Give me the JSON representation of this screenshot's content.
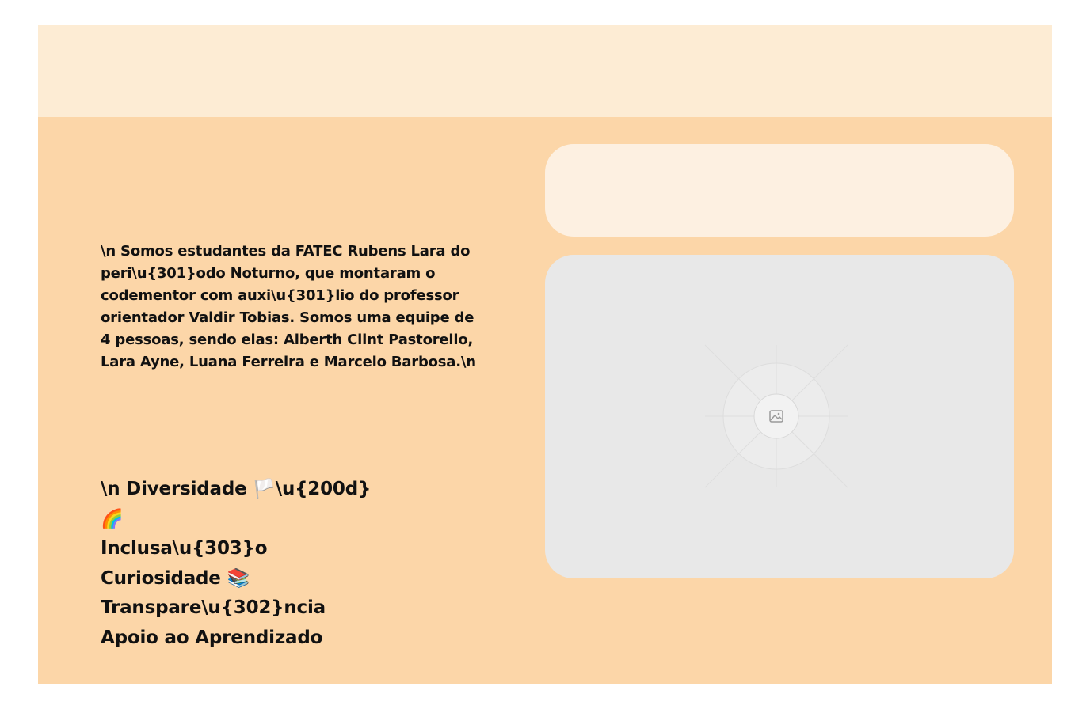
{
  "about": {
    "text": "\\n Somos estudantes da FATEC Rubens Lara do peri\\u{301}odo Noturno, que montaram o codementor com auxi\\u{301}lio do professor orientador Valdir Tobias. Somos uma equipe de 4 pessoas, sendo elas: Alberth Clint Pastorello, Lara Ayne, Luana Ferreira e Marcelo Barbosa.\\n"
  },
  "values": [
    "\\n Diversidade 🏳️\\u{200d}",
    "🌈",
    "Inclusa\\u{303}o",
    "Curiosidade 📚",
    "Transpare\\u{302}ncia",
    "Apoio ao Aprendizado"
  ],
  "image": {
    "icon": "image-icon"
  },
  "colors": {
    "header_band": "#fdecd4",
    "section_bg": "#fcd6a8",
    "title_card": "#fdf0e1",
    "image_card": "#e8e8e8",
    "text": "#111111"
  }
}
